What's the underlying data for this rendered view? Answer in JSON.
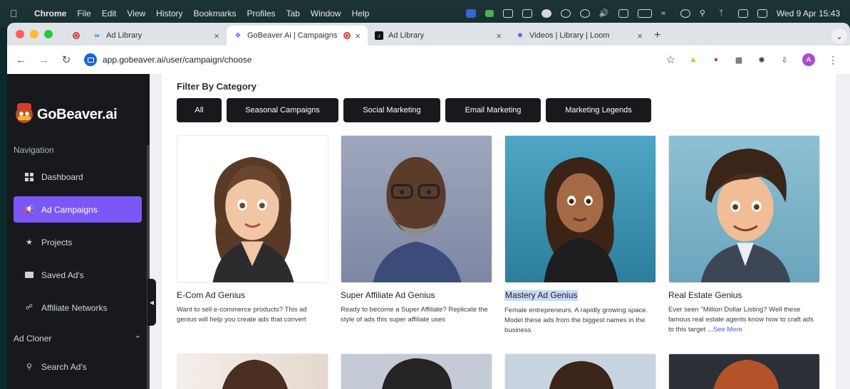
{
  "menubar": {
    "app": "Chrome",
    "items": [
      "File",
      "Edit",
      "View",
      "History",
      "Bookmarks",
      "Profiles",
      "Tab",
      "Window",
      "Help"
    ],
    "clock": "Wed 9 Apr  15:43"
  },
  "browser": {
    "tabs": [
      {
        "title": "Ad Library",
        "icon": "meta-icon",
        "active": false
      },
      {
        "title": "GoBeaver Ai | Campaigns",
        "icon": "gobeaver-icon",
        "active": true
      },
      {
        "title": "Ad Library",
        "icon": "tiktok-icon",
        "active": false
      },
      {
        "title": "Videos | Library | Loom",
        "icon": "loom-icon",
        "active": false
      }
    ],
    "url": "app.gobeaver.ai/user/campaign/choose",
    "profile_initial": "A"
  },
  "sidebar": {
    "brand": "GoBeaver.ai",
    "navigation_label": "Navigation",
    "items": [
      {
        "label": "Dashboard",
        "icon": "dashboard-icon"
      },
      {
        "label": "Ad Campaigns",
        "icon": "megaphone-icon",
        "active": true
      },
      {
        "label": "Projects",
        "icon": "star-icon"
      },
      {
        "label": "Saved Ad's",
        "icon": "folder-icon"
      },
      {
        "label": "Affiliate Networks",
        "icon": "network-icon"
      }
    ],
    "ad_cloner_label": "Ad Cloner",
    "ad_cloner_items": [
      {
        "label": "Search Ad's",
        "icon": "search-icon"
      }
    ]
  },
  "main": {
    "filter_title": "Filter By Category",
    "filters": [
      "All",
      "Seasonal Campaigns",
      "Social Marketing",
      "Email Marketing",
      "Marketing Legends"
    ],
    "cards": [
      {
        "title": "E-Com Ad Genius",
        "description": "Want to sell e-commerce products? This ad genius will help you create ads that convert"
      },
      {
        "title": "Super Affiliate Ad Genius",
        "description": "Ready to become a Super Affiliate? Replicate the style of ads this super affiliate uses"
      },
      {
        "title": "Mastery Ad Genius",
        "description": "Female entrepreneurs. A rapidly growing space. Model these ads from the biggest names in the business",
        "selected": true
      },
      {
        "title": "Real Estate Genius",
        "description": "Ever seen \"Million Dollar Listing? Well these famous real estate agents know how to craft ads to this target ...",
        "see_more": "See More"
      }
    ]
  },
  "colors": {
    "sidebar_bg": "#17191d",
    "accent": "#7b57f5",
    "chip_bg": "#17191d",
    "link": "#3b5bdb"
  }
}
